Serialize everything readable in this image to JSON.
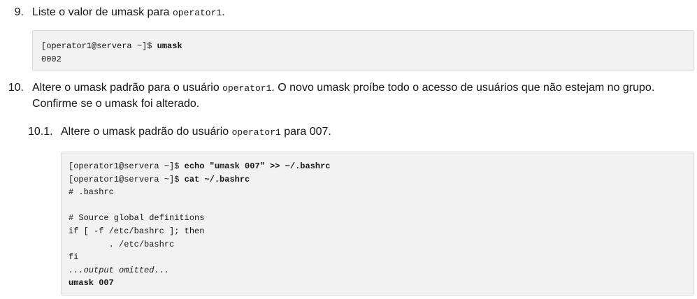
{
  "step9": {
    "number": "9.",
    "text_before": "Liste o valor de umask para ",
    "code": "operator1",
    "text_after": ".",
    "block": {
      "prompt": "[operator1@servera ~]$ ",
      "command": "umask",
      "output": "0002"
    }
  },
  "step10": {
    "number": "10.",
    "line1_before": "Altere o umask padrão para o usuário ",
    "line1_code": "operator1",
    "line1_after": ". O novo umask proíbe todo o acesso de usuários que não estejam no grupo.",
    "line2": "Confirme se o umask foi alterado."
  },
  "step10_1": {
    "number": "10.1.",
    "text_before": "Altere o umask padrão do usuário ",
    "code": "operator1",
    "text_after": " para 007.",
    "block": {
      "prompt1": "[operator1@servera ~]$ ",
      "command1": "echo \"umask 007\" >> ~/.bashrc",
      "prompt2": "[operator1@servera ~]$ ",
      "command2": "cat ~/.bashrc",
      "out1": "# .bashrc",
      "out2": "",
      "out3": "# Source global definitions",
      "out4": "if [ -f /etc/bashrc ]; then",
      "out5": "        . /etc/bashrc",
      "out6": "fi",
      "omitted": "...output omitted...",
      "last": "umask 007"
    }
  }
}
